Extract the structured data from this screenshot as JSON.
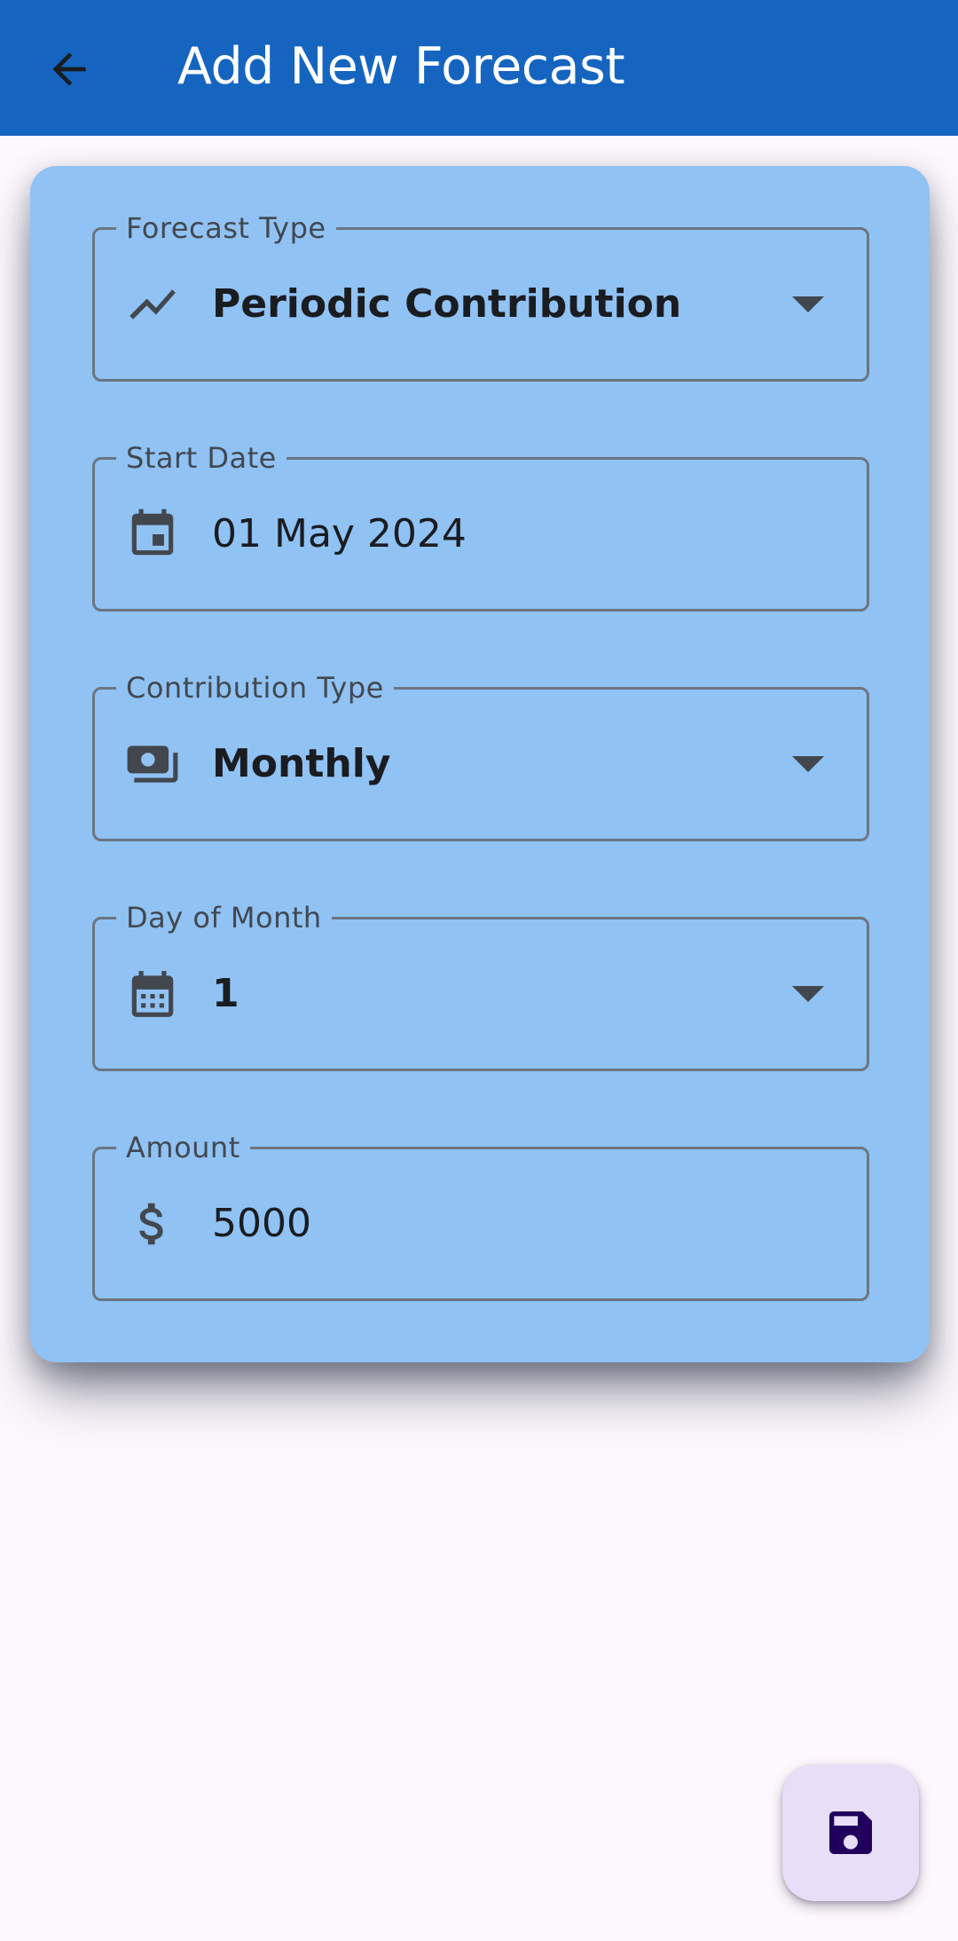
{
  "app_bar": {
    "title": "Add New Forecast",
    "back_icon": "arrow-back-icon",
    "background_color": "#1565c0"
  },
  "form": {
    "card_color": "#90c2f4",
    "fields": {
      "forecast_type": {
        "label": "Forecast Type",
        "value": "Periodic Contribution",
        "icon": "trending-up-icon"
      },
      "start_date": {
        "label": "Start Date",
        "value": "01 May 2024",
        "icon": "event-icon"
      },
      "contribution_type": {
        "label": "Contribution Type",
        "value": "Monthly",
        "icon": "payments-icon"
      },
      "day_of_month": {
        "label": "Day of Month",
        "value": "1",
        "icon": "calendar-month-icon"
      },
      "amount": {
        "label": "Amount",
        "value": "5000",
        "icon": "dollar-sign-icon"
      }
    }
  },
  "fab": {
    "icon": "save-icon",
    "color": "#e8def8"
  }
}
